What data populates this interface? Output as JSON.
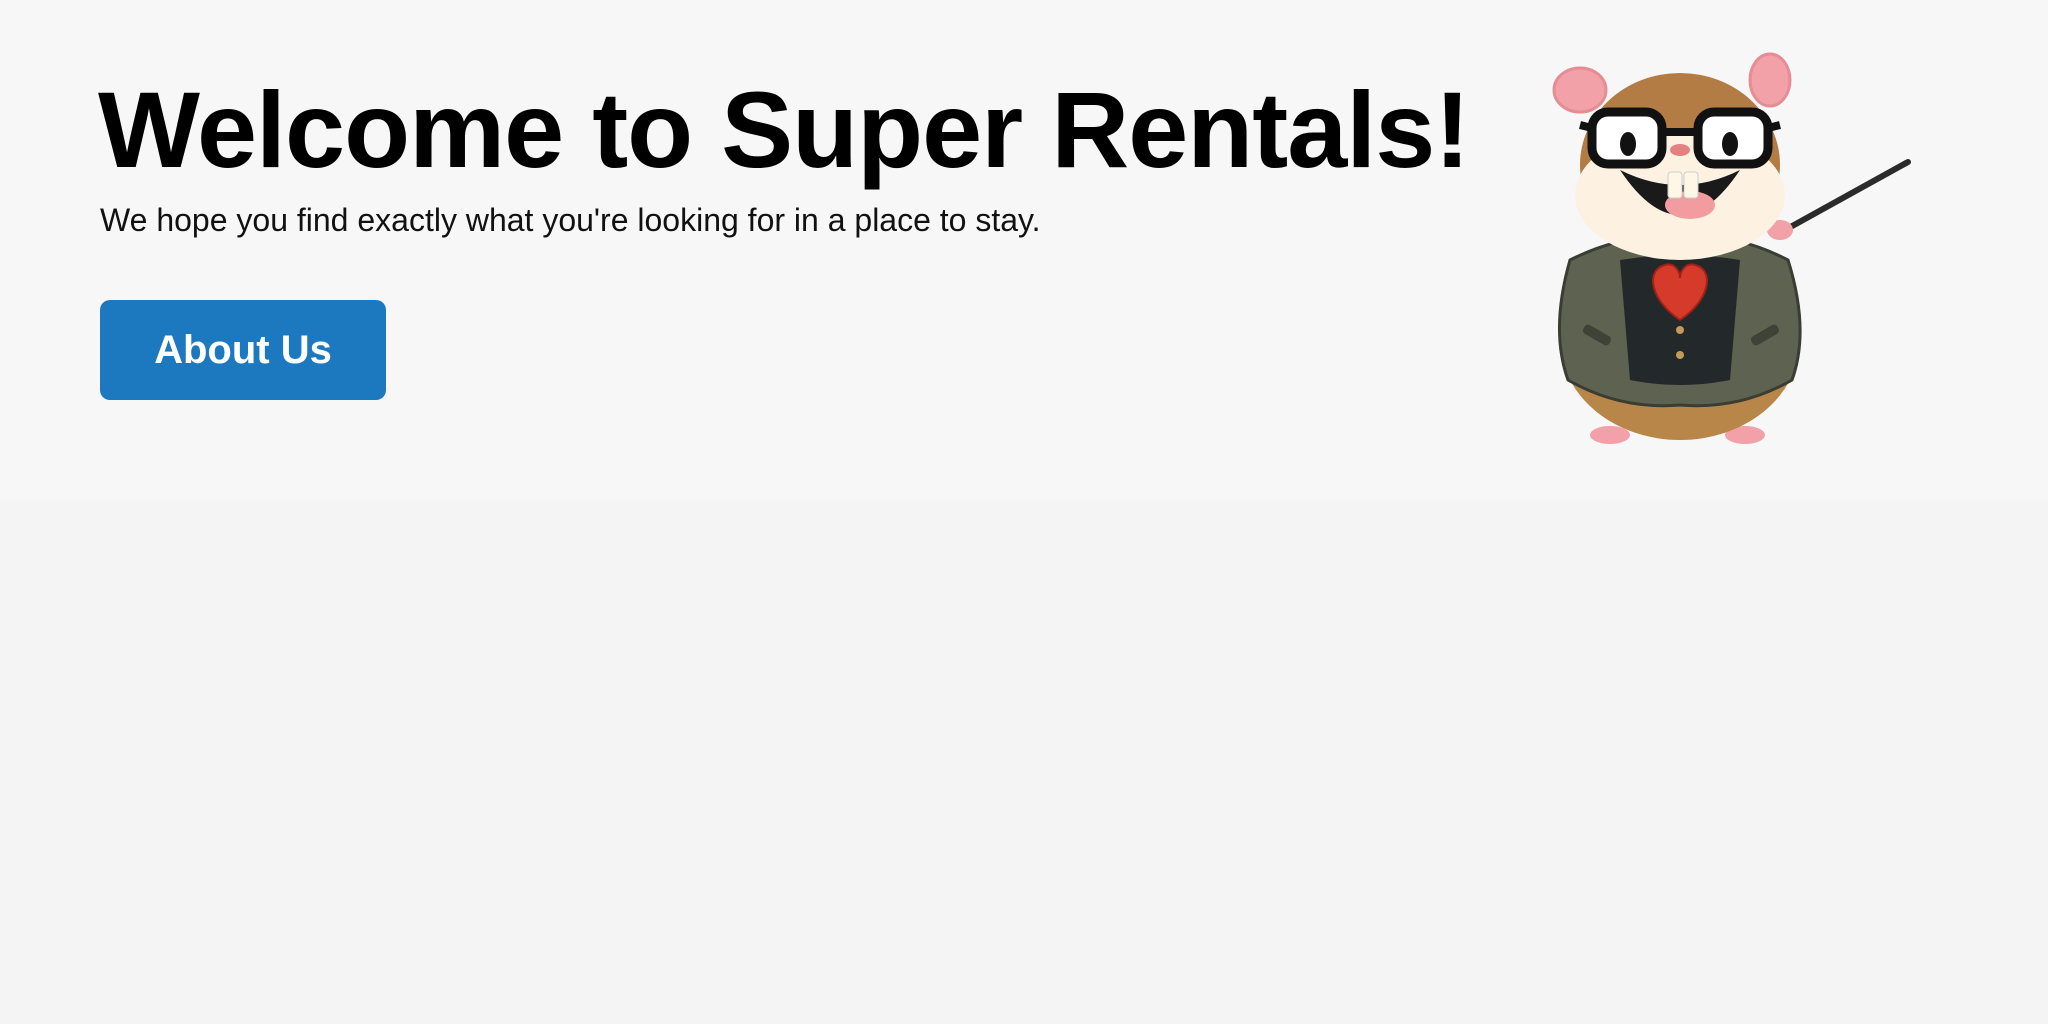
{
  "hero": {
    "title": "Welcome to Super Rentals!",
    "subtitle": "We hope you find exactly what you're looking for in a place to stay.",
    "button_label": "About Us",
    "accent_color": "#1c79c0"
  },
  "mascot": {
    "icon": "tomster-hamster-mascot"
  }
}
